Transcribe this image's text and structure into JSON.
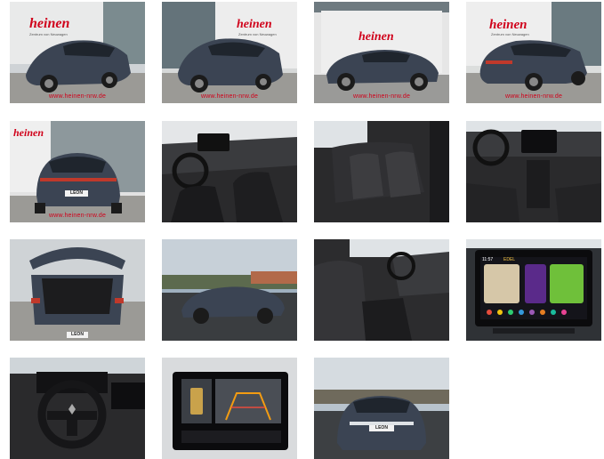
{
  "dealer": {
    "brand": "heinen",
    "tagline": "Zentrum von Neuwagen",
    "watermark": "www.heinen-nrw.de"
  },
  "vehicle": {
    "badge": "LEON"
  },
  "infotainment": {
    "time": "11:57",
    "status": "EDEL"
  },
  "colors": {
    "body": "#3b4453",
    "brand_red": "#d0021b",
    "interior": "#2a2a2c"
  },
  "photos": [
    {
      "name": "front-left"
    },
    {
      "name": "front-left-2"
    },
    {
      "name": "side"
    },
    {
      "name": "rear-left"
    },
    {
      "name": "rear"
    },
    {
      "name": "front-interior"
    },
    {
      "name": "rear-seats"
    },
    {
      "name": "dashboard"
    },
    {
      "name": "trunk"
    },
    {
      "name": "side-outdoor"
    },
    {
      "name": "front-seats"
    },
    {
      "name": "infotainment-screen"
    },
    {
      "name": "steering-wheel"
    },
    {
      "name": "rear-camera-display"
    },
    {
      "name": "front-outdoor"
    }
  ]
}
